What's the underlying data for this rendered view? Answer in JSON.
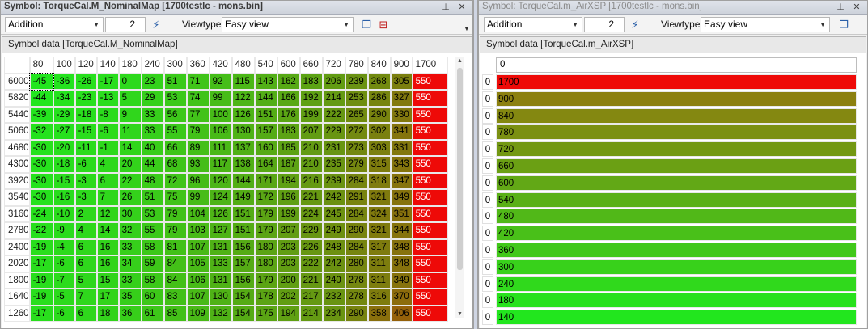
{
  "left": {
    "title": "Symbol: TorqueCal.M_NominalMap [1700testlc - mons.bin]",
    "operation": "Addition",
    "value": "2",
    "viewtype_label": "Viewtype",
    "viewtype": "Easy view",
    "caption": "Symbol data [TorqueCal.M_NominalMap]",
    "columns": [
      "80",
      "100",
      "120",
      "140",
      "180",
      "240",
      "300",
      "360",
      "420",
      "480",
      "540",
      "600",
      "660",
      "720",
      "780",
      "840",
      "900",
      "1700"
    ],
    "rows": [
      {
        "label": "6000",
        "cells": [
          "-45",
          "-36",
          "-26",
          "-17",
          "0",
          "23",
          "51",
          "71",
          "92",
          "115",
          "143",
          "162",
          "183",
          "206",
          "239",
          "268",
          "305",
          "550"
        ]
      },
      {
        "label": "5820",
        "cells": [
          "-44",
          "-34",
          "-23",
          "-13",
          "5",
          "29",
          "53",
          "74",
          "99",
          "122",
          "144",
          "166",
          "192",
          "214",
          "253",
          "286",
          "327",
          "550"
        ]
      },
      {
        "label": "5440",
        "cells": [
          "-39",
          "-29",
          "-18",
          "-8",
          "9",
          "33",
          "56",
          "77",
          "100",
          "126",
          "151",
          "176",
          "199",
          "222",
          "265",
          "290",
          "330",
          "550"
        ]
      },
      {
        "label": "5060",
        "cells": [
          "-32",
          "-27",
          "-15",
          "-6",
          "11",
          "33",
          "55",
          "79",
          "106",
          "130",
          "157",
          "183",
          "207",
          "229",
          "272",
          "302",
          "341",
          "550"
        ]
      },
      {
        "label": "4680",
        "cells": [
          "-30",
          "-20",
          "-11",
          "-1",
          "14",
          "40",
          "66",
          "89",
          "111",
          "137",
          "160",
          "185",
          "210",
          "231",
          "273",
          "303",
          "331",
          "550"
        ]
      },
      {
        "label": "4300",
        "cells": [
          "-30",
          "-18",
          "-6",
          "4",
          "20",
          "44",
          "68",
          "93",
          "117",
          "138",
          "164",
          "187",
          "210",
          "235",
          "279",
          "315",
          "343",
          "550"
        ]
      },
      {
        "label": "3920",
        "cells": [
          "-30",
          "-15",
          "-3",
          "6",
          "22",
          "48",
          "72",
          "96",
          "120",
          "144",
          "171",
          "194",
          "216",
          "239",
          "284",
          "318",
          "347",
          "550"
        ]
      },
      {
        "label": "3540",
        "cells": [
          "-30",
          "-16",
          "-3",
          "7",
          "26",
          "51",
          "75",
          "99",
          "124",
          "149",
          "172",
          "196",
          "221",
          "242",
          "291",
          "321",
          "349",
          "550"
        ]
      },
      {
        "label": "3160",
        "cells": [
          "-24",
          "-10",
          "2",
          "12",
          "30",
          "53",
          "79",
          "104",
          "126",
          "151",
          "179",
          "199",
          "224",
          "245",
          "284",
          "324",
          "351",
          "550"
        ]
      },
      {
        "label": "2780",
        "cells": [
          "-22",
          "-9",
          "4",
          "14",
          "32",
          "55",
          "79",
          "103",
          "127",
          "151",
          "179",
          "207",
          "229",
          "249",
          "290",
          "321",
          "344",
          "550"
        ]
      },
      {
        "label": "2400",
        "cells": [
          "-19",
          "-4",
          "6",
          "16",
          "33",
          "58",
          "81",
          "107",
          "131",
          "156",
          "180",
          "203",
          "226",
          "248",
          "284",
          "317",
          "348",
          "550"
        ]
      },
      {
        "label": "2020",
        "cells": [
          "-17",
          "-6",
          "6",
          "16",
          "34",
          "59",
          "84",
          "105",
          "133",
          "157",
          "180",
          "203",
          "222",
          "242",
          "280",
          "311",
          "348",
          "550"
        ]
      },
      {
        "label": "1800",
        "cells": [
          "-19",
          "-7",
          "5",
          "15",
          "33",
          "58",
          "84",
          "106",
          "131",
          "156",
          "179",
          "200",
          "221",
          "240",
          "278",
          "311",
          "349",
          "550"
        ]
      },
      {
        "label": "1640",
        "cells": [
          "-19",
          "-5",
          "7",
          "17",
          "35",
          "60",
          "83",
          "107",
          "130",
          "154",
          "178",
          "202",
          "217",
          "232",
          "278",
          "316",
          "370",
          "550"
        ]
      },
      {
        "label": "1260",
        "cells": [
          "-17",
          "-6",
          "6",
          "18",
          "36",
          "61",
          "85",
          "109",
          "132",
          "154",
          "175",
          "194",
          "214",
          "234",
          "290",
          "358",
          "406",
          "550"
        ]
      }
    ]
  },
  "right": {
    "title": "Symbol: TorqueCal.m_AirXSP [1700testlc - mons.bin]",
    "operation": "Addition",
    "value": "2",
    "viewtype_label": "Viewtype",
    "viewtype": "Easy view",
    "caption": "Symbol data [TorqueCal.m_AirXSP]",
    "header": "0",
    "rows": [
      {
        "idx": "0",
        "value": "1700"
      },
      {
        "idx": "0",
        "value": "900"
      },
      {
        "idx": "0",
        "value": "840"
      },
      {
        "idx": "0",
        "value": "780"
      },
      {
        "idx": "0",
        "value": "720"
      },
      {
        "idx": "0",
        "value": "660"
      },
      {
        "idx": "0",
        "value": "600"
      },
      {
        "idx": "0",
        "value": "540"
      },
      {
        "idx": "0",
        "value": "480"
      },
      {
        "idx": "0",
        "value": "420"
      },
      {
        "idx": "0",
        "value": "360"
      },
      {
        "idx": "0",
        "value": "300"
      },
      {
        "idx": "0",
        "value": "240"
      },
      {
        "idx": "0",
        "value": "180"
      },
      {
        "idx": "0",
        "value": "140"
      }
    ]
  },
  "icons": {
    "pin": "pin-icon",
    "close": "close-icon",
    "graph": "graph-icon",
    "window": "window-icon",
    "export": "export-icon"
  },
  "colors": {
    "low": "#22e61e",
    "mid": "#8f8a14",
    "high": "#ee0a08"
  }
}
